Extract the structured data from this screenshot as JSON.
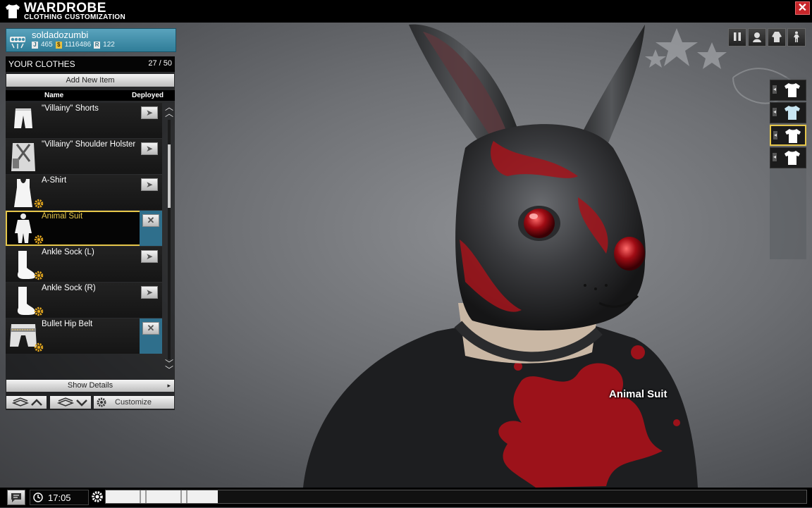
{
  "header": {
    "title": "WARDROBE",
    "subtitle": "CLOTHING CUSTOMIZATION",
    "close_symbol": "✕"
  },
  "user": {
    "name": "soldadozumbi",
    "stat_icons": [
      "J",
      "$",
      "R"
    ],
    "stats": {
      "jp": "465",
      "money": "1116486",
      "rep": "122"
    }
  },
  "clothes": {
    "title": "YOUR CLOTHES",
    "count": "27 / 50",
    "add_label": "Add New Item",
    "columns": {
      "name": "Name",
      "deployed": "Deployed"
    },
    "scroll_position": 0.35,
    "items": [
      {
        "name": "\"Villainy\" Shorts",
        "deployed": false,
        "custom": false,
        "icon": "shorts-icon"
      },
      {
        "name": "\"Villainy\" Shoulder Holster",
        "deployed": false,
        "custom": false,
        "icon": "holster-icon"
      },
      {
        "name": "A-Shirt",
        "deployed": false,
        "custom": true,
        "icon": "tanktop-icon"
      },
      {
        "name": "Animal Suit",
        "deployed": true,
        "custom": true,
        "selected": true,
        "icon": "suit-icon"
      },
      {
        "name": "Ankle Sock (L)",
        "deployed": false,
        "custom": true,
        "icon": "sock-icon"
      },
      {
        "name": "Ankle Sock (R)",
        "deployed": false,
        "custom": true,
        "icon": "sock-icon"
      },
      {
        "name": "Bullet Hip Belt",
        "deployed": true,
        "custom": true,
        "icon": "belt-icon"
      }
    ],
    "show_details": "Show Details",
    "show_details_arrow": "▸",
    "customize": "Customize"
  },
  "preview": {
    "item_label": "Animal Suit"
  },
  "footer": {
    "time": "17:05",
    "progress_fraction": 0.16
  },
  "colors": {
    "accent_gold": "#e5c64a",
    "deployed_blue": "#2f6f8c",
    "user_card": "#3f8eaa",
    "close_red": "#c8262a",
    "blood_red": "#a3141b"
  }
}
